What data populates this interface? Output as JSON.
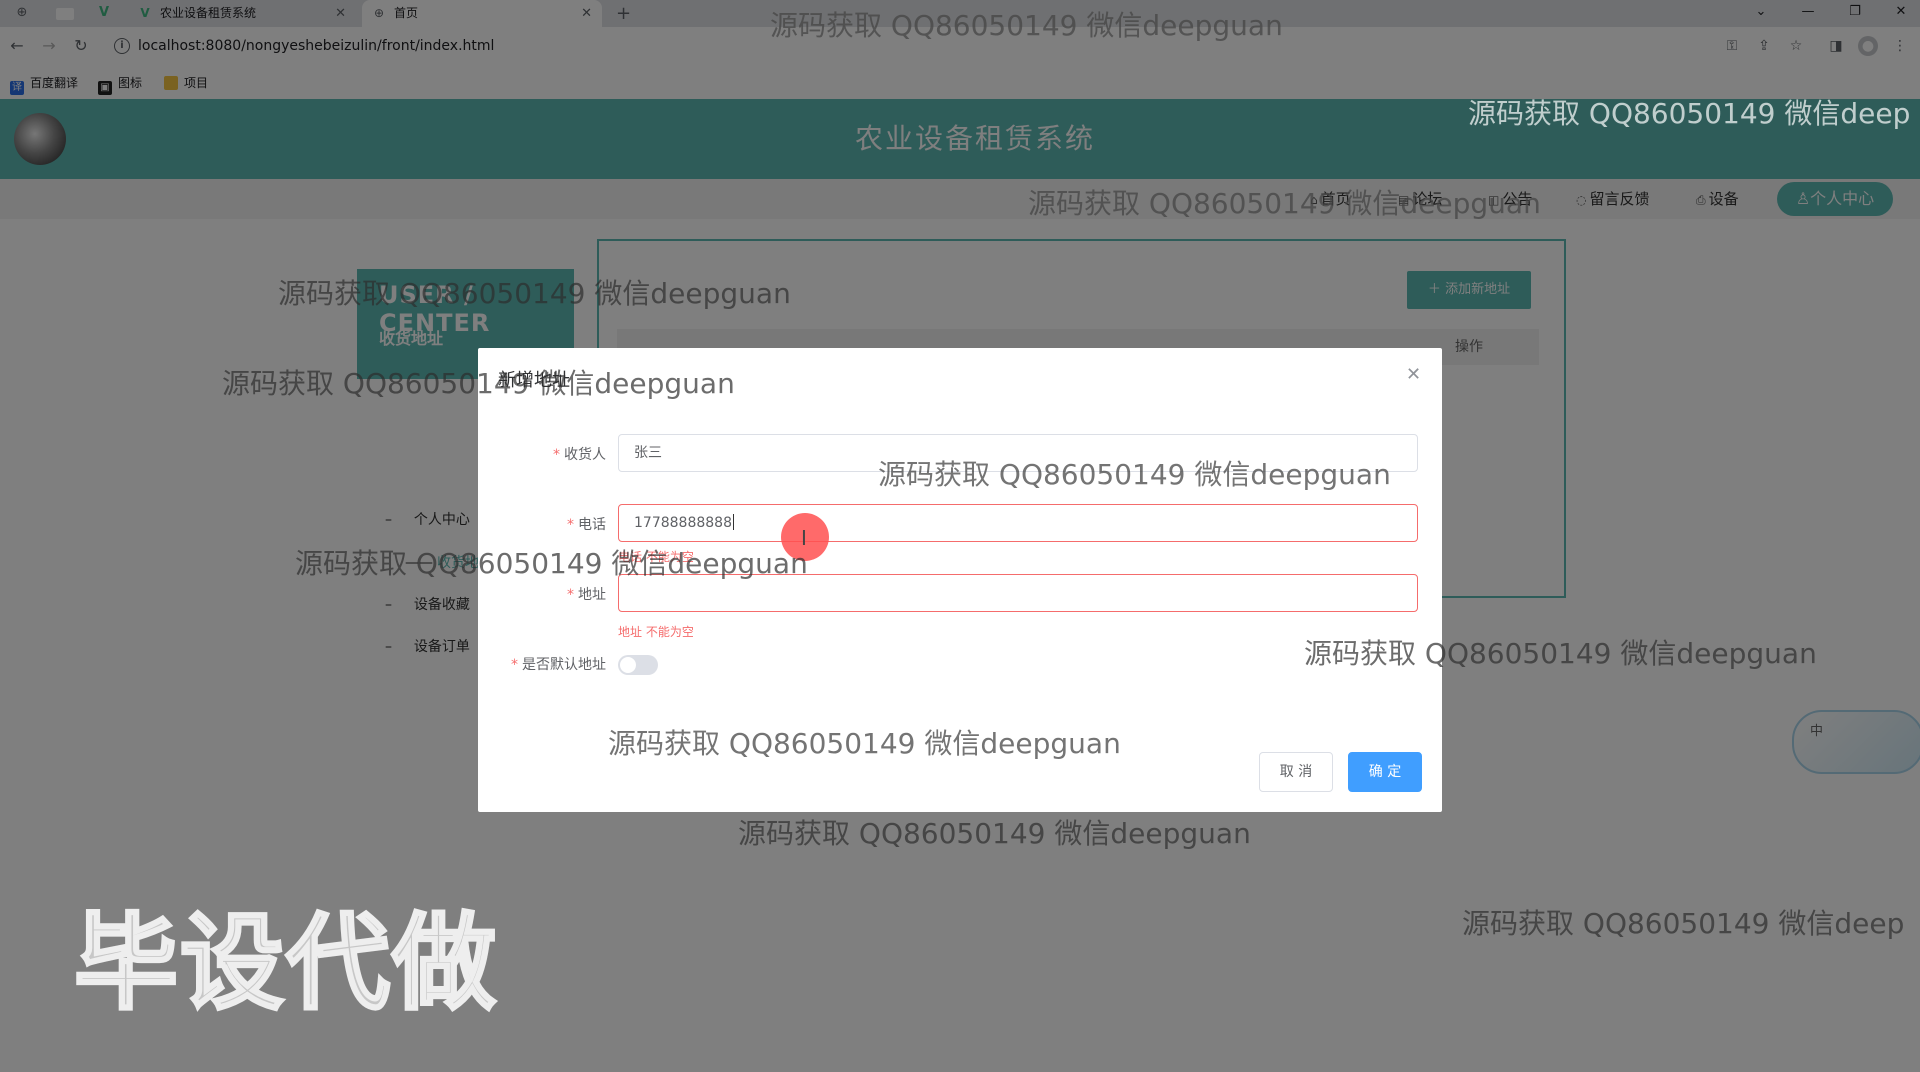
{
  "browser": {
    "tabs": [
      {
        "label": "农业设备租赁系统",
        "active": false,
        "favicon": "vue-v-icon"
      },
      {
        "label": "首页",
        "active": true,
        "favicon": "globe-icon"
      }
    ],
    "new_tab": "+",
    "url": "localhost:8080/nongyeshebeizulin/front/index.html",
    "bookmarks": [
      {
        "label": "百度翻译",
        "icon": "translate-icon"
      },
      {
        "label": "图标",
        "icon": "image-icon"
      },
      {
        "label": "项目",
        "icon": "folder-icon"
      }
    ]
  },
  "site": {
    "title": "农业设备租赁系统",
    "nav": [
      {
        "label": "首页",
        "icon": "home-icon"
      },
      {
        "label": "论坛",
        "icon": "forum-icon"
      },
      {
        "label": "公告",
        "icon": "notice-icon"
      },
      {
        "label": "留言反馈",
        "icon": "feedback-icon"
      },
      {
        "label": "设备",
        "icon": "device-icon"
      }
    ],
    "user_center_button": "个人中心",
    "accent_color": "#5cb8b2"
  },
  "user_center": {
    "title": "USER / CENTER",
    "subtitle": "收货地址",
    "menu": [
      "个人中心",
      "收货地址",
      "设备收藏",
      "设备订单"
    ]
  },
  "content": {
    "add_button": "添加新地址",
    "table_op_header": "操作"
  },
  "dialog": {
    "title": "新增地址",
    "fields": {
      "receiver": {
        "label": "收货人",
        "value": "张三"
      },
      "phone": {
        "label": "电话",
        "value": "17788888888",
        "error": "电话 不能为空"
      },
      "address": {
        "label": "地址",
        "value": "",
        "error": "地址 不能为空"
      },
      "is_default": {
        "label": "是否默认地址",
        "on": false
      }
    },
    "cancel_label": "取 消",
    "confirm_label": "确 定",
    "primary_color": "#409eff",
    "error_color": "#f56c6c"
  },
  "floating_widget": {
    "label": "中"
  },
  "watermarks": {
    "text": "源码获取 QQ86050149 微信deepguan",
    "truncated": "源码获取 QQ86050149 微信deep",
    "big": "毕设代做"
  }
}
